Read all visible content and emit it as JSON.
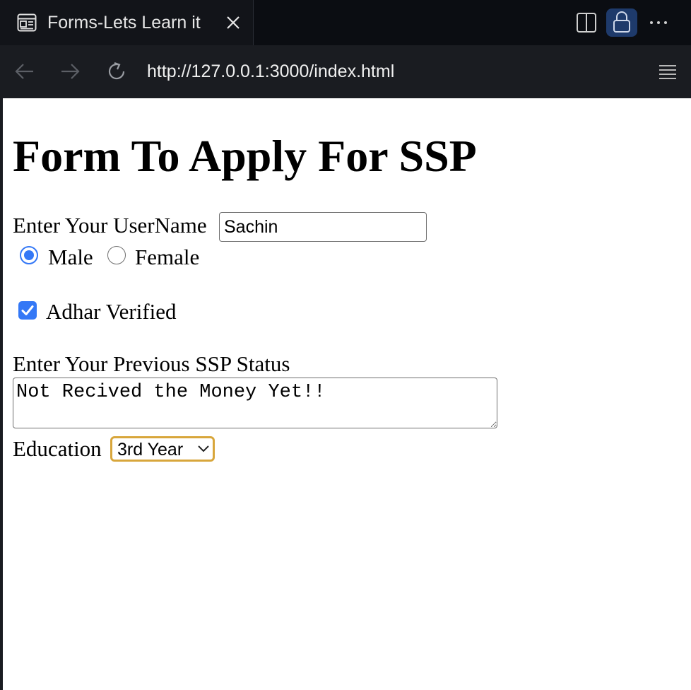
{
  "browser": {
    "tab_title": "Forms-Lets Learn it",
    "url": "http://127.0.0.1:3000/index.html"
  },
  "icons": {
    "tab": "page-icon",
    "close": "close-icon",
    "split": "split-view-icon",
    "lock": "lock-icon",
    "more": "more-icon",
    "back": "arrow-left-icon",
    "forward": "arrow-right-icon",
    "reload": "reload-icon",
    "menu": "menu-icon"
  },
  "colors": {
    "accent": "#3478f6",
    "focus": "#d8a63b",
    "chrome_bg": "#0b0d12",
    "lock_bg": "#1e3a6b"
  },
  "page": {
    "heading": "Form To Apply For SSP",
    "username_label": "Enter Your UserName",
    "username_value": "Sachin",
    "gender": {
      "male_label": "Male",
      "female_label": "Female",
      "selected": "Male"
    },
    "adhar_label": "Adhar Verified",
    "adhar_checked": true,
    "status_label": "Enter Your Previous SSP Status",
    "status_value": "Not Recived the Money Yet!!",
    "education_label": "Education",
    "education_selected": "3rd Year"
  }
}
